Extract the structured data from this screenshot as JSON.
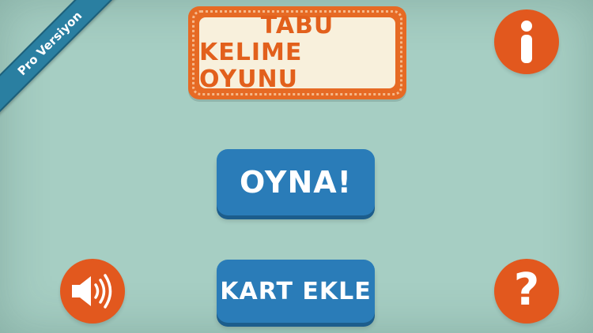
{
  "ribbon": {
    "label": "Pro Versiyon"
  },
  "title": {
    "line1": "TABU",
    "line2": "KELIME OYUNU"
  },
  "buttons": {
    "play_label": "OYNA!",
    "add_card_label": "KART EKLE"
  },
  "icons": {
    "info": "info-icon",
    "sound": "speaker-icon",
    "help": "question-icon",
    "help_glyph": "?"
  },
  "colors": {
    "background": "#a6cec3",
    "orange": "#e2581e",
    "blue": "#2a7cb8",
    "ribbon": "#2a7fa1",
    "title_text": "#e2601c",
    "panel": "#f8f0dc"
  }
}
